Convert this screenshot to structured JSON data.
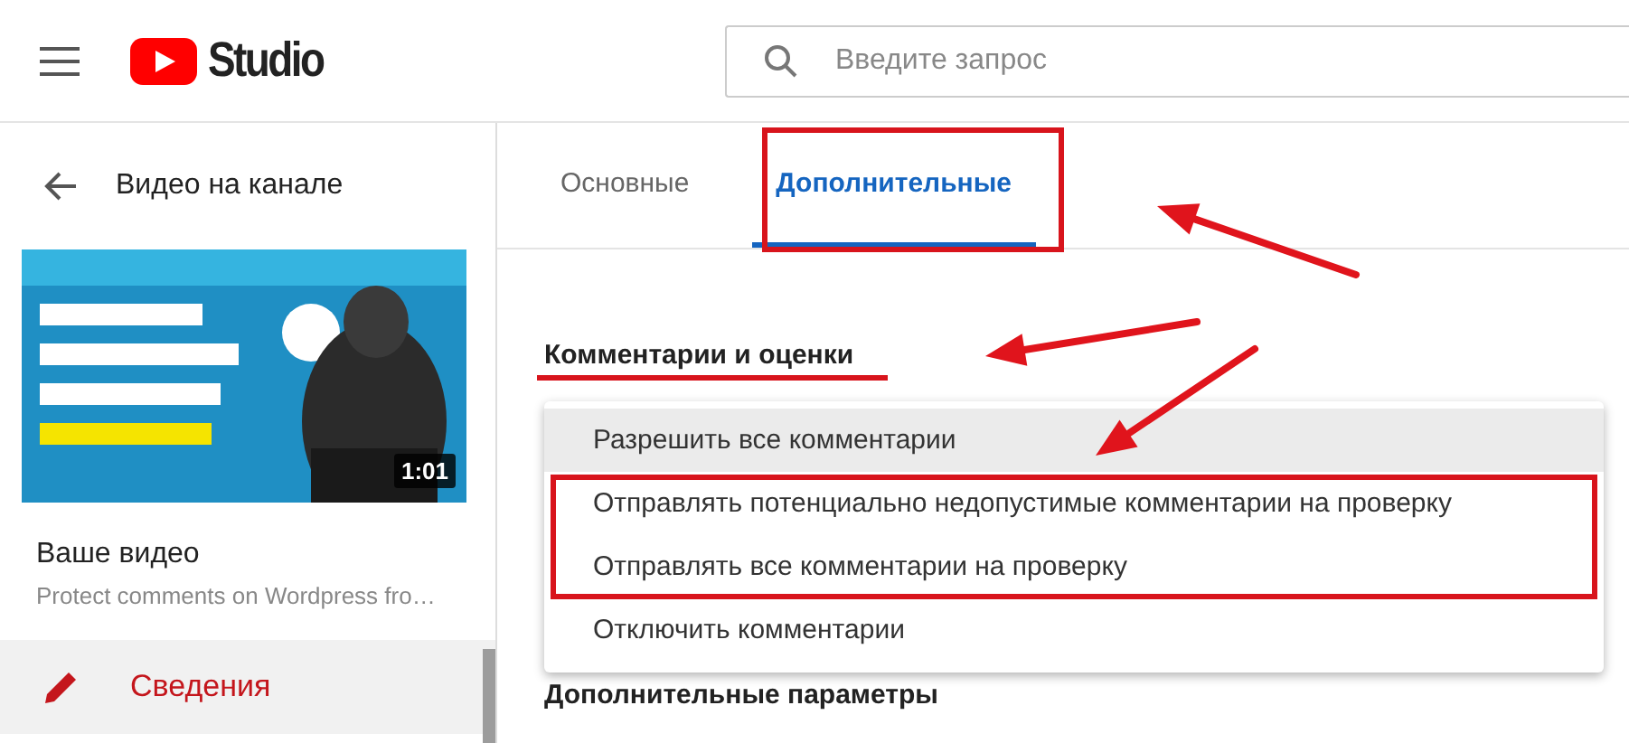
{
  "header": {
    "logo_text": "Studio",
    "search": {
      "placeholder": "Введите запрос"
    }
  },
  "sidebar": {
    "back_label": "Видео на канале",
    "video": {
      "thumbnail": {
        "kind": "picture",
        "duration": "1:01"
      },
      "heading": "Ваше видео",
      "title": "Protect comments on Wordpress fro…"
    },
    "items": [
      {
        "label": "Сведения",
        "selected": true
      }
    ]
  },
  "tabs": [
    {
      "label": "Основные",
      "selected": false
    },
    {
      "label": "Дополнительные",
      "selected": true
    }
  ],
  "section": {
    "heading": "Комментарии и оценки"
  },
  "menu": {
    "items": [
      {
        "label": "Разрешить все комментарии",
        "selected": true
      },
      {
        "label": "Отправлять потенциально недопустимые комментарии на проверку",
        "selected": false
      },
      {
        "label": "Отправлять все комментарии на проверку",
        "selected": false
      },
      {
        "label": "Отключить комментарии",
        "selected": false
      }
    ]
  },
  "next_section": {
    "heading": "Дополнительные параметры"
  }
}
